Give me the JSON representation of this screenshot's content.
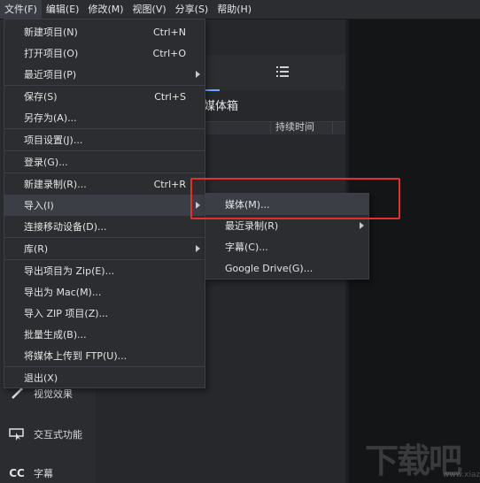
{
  "menubar": {
    "items": [
      {
        "label": "文件(F)"
      },
      {
        "label": "编辑(E)"
      },
      {
        "label": "修改(M)"
      },
      {
        "label": "视图(V)"
      },
      {
        "label": "分享(S)"
      },
      {
        "label": "帮助(H)"
      }
    ]
  },
  "panel": {
    "media_title": "媒体箱",
    "column_duration": "持续时间"
  },
  "tools": [
    {
      "label": "视觉效果",
      "icon": "wand-icon"
    },
    {
      "label": "交互式功能",
      "icon": "interactive-icon"
    },
    {
      "label": "字幕",
      "icon": "cc-icon",
      "glyph": "CC"
    }
  ],
  "file_menu": {
    "items": [
      {
        "label": "新建项目(N)",
        "shortcut": "Ctrl+N"
      },
      {
        "label": "打开项目(O)",
        "shortcut": "Ctrl+O"
      },
      {
        "label": "最近项目(P)",
        "submenu": true
      },
      {
        "label": "保存(S)",
        "shortcut": "Ctrl+S"
      },
      {
        "label": "另存为(A)..."
      },
      {
        "label": "项目设置(J)..."
      },
      {
        "label": "登录(G)..."
      },
      {
        "label": "新建录制(R)...",
        "shortcut": "Ctrl+R"
      },
      {
        "label": "导入(I)",
        "submenu": true
      },
      {
        "label": "连接移动设备(D)..."
      },
      {
        "label": "库(R)",
        "submenu": true
      },
      {
        "label": "导出项目为 Zip(E)..."
      },
      {
        "label": "导出为 Mac(M)..."
      },
      {
        "label": "导入 ZIP 项目(Z)..."
      },
      {
        "label": "批量生成(B)..."
      },
      {
        "label": "将媒体上传到 FTP(U)..."
      },
      {
        "label": "退出(X)"
      }
    ]
  },
  "import_submenu": {
    "items": [
      {
        "label": "媒体(M)..."
      },
      {
        "label": "最近录制(R)",
        "submenu": true
      },
      {
        "label": "字幕(C)..."
      },
      {
        "label": "Google Drive(G)..."
      }
    ]
  },
  "watermark": {
    "text": "下载吧",
    "sub": "www.xiazaiba.com"
  },
  "colors": {
    "highlight_box": "#e03131",
    "accent": "#6fa8ff",
    "menu_bg": "#2b2d31"
  }
}
